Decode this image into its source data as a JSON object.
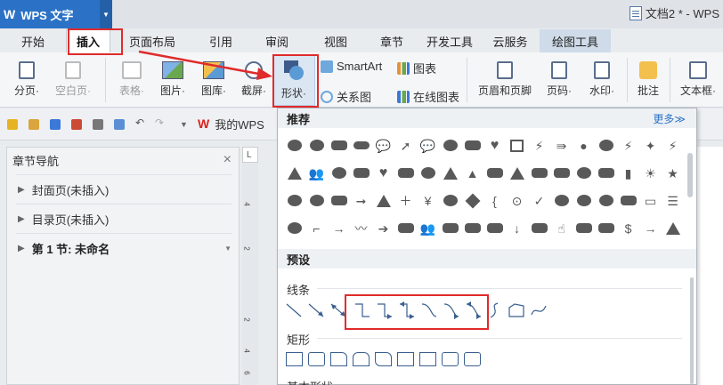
{
  "app": {
    "name": "WPS 文字",
    "document_title": "文档2 * - WPS"
  },
  "menu_tabs": [
    {
      "label": "开始",
      "w": 74
    },
    {
      "label": "插入",
      "w": 50
    },
    {
      "label": "页面布局",
      "w": 94
    },
    {
      "label": "引用",
      "w": 60
    },
    {
      "label": "审阅",
      "w": 66
    },
    {
      "label": "视图",
      "w": 66
    },
    {
      "label": "章节",
      "w": 60
    },
    {
      "label": "开发工具",
      "w": 70
    },
    {
      "label": "云服务",
      "w": 66
    },
    {
      "label": "绘图工具",
      "w": 80
    }
  ],
  "ribbon": {
    "page_break": "分页·",
    "blank_page": "空白页·",
    "table": "表格·",
    "picture": "图片·",
    "gallery": "图库·",
    "screenshot": "截屏·",
    "shapes": "形状·",
    "smartart": "SmartArt",
    "chart": "图表",
    "relation": "关系图",
    "online_chart": "在线图表",
    "header_footer": "页眉和页脚",
    "page_number": "页码·",
    "watermark": "水印·",
    "comment": "批注",
    "textbox": "文本框·"
  },
  "quick_access": {
    "wps_tab": "我的WPS"
  },
  "nav_pane": {
    "title": "章节导航",
    "close": "×",
    "items": [
      {
        "label": "封面页(未插入)"
      },
      {
        "label": "目录页(未插入)"
      },
      {
        "label": "第 1 节: 未命名"
      }
    ]
  },
  "ruler": {
    "numbers": [
      "4",
      "2",
      "2",
      "4",
      "6"
    ],
    "corner": "L"
  },
  "shapes_popup": {
    "recommended": "推荐",
    "more": "更多≫",
    "presets": "预设",
    "lines": "线条",
    "rectangles": "矩形",
    "basic": "基本形状"
  },
  "colors": {
    "accent": "#2b72c6",
    "highlight": "#e02b2b",
    "shape": "#595959"
  }
}
